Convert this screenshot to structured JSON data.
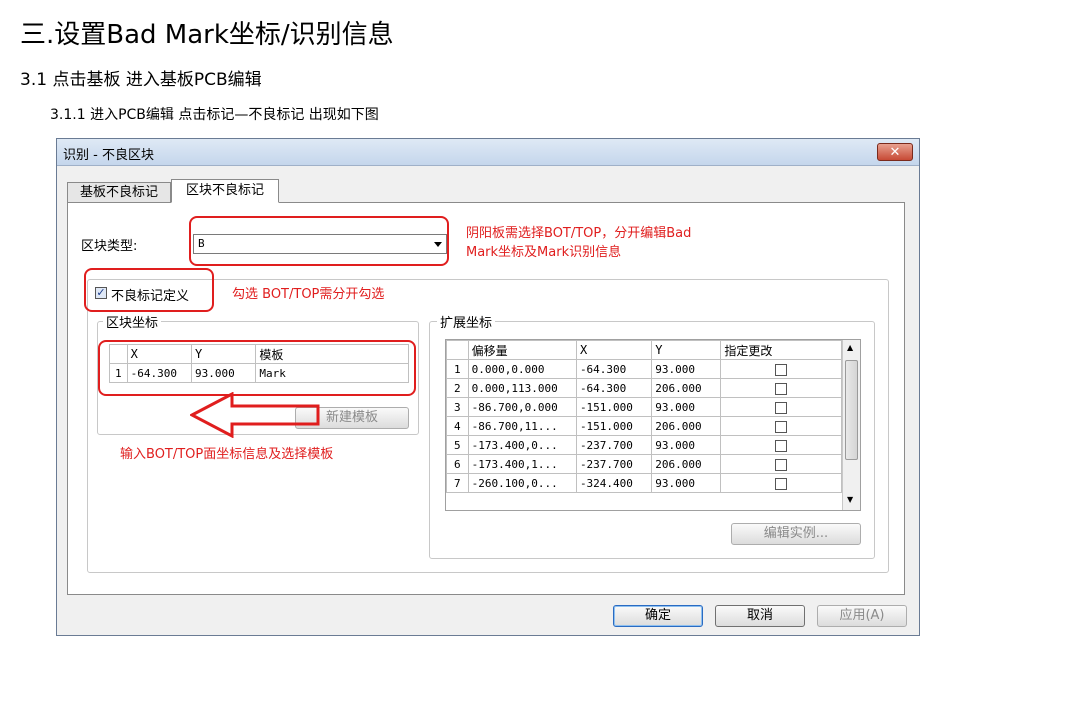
{
  "doc": {
    "h1": "三.设置Bad Mark坐标/识别信息",
    "h2": "3.1 点击基板   进入基板PCB编辑",
    "h3": "3.1.1 进入PCB编辑 点击标记—不良标记  出现如下图"
  },
  "dialog": {
    "title": "识别 - 不良区块",
    "close_glyph": "✕",
    "tabs": [
      "基板不良标记",
      "区块不良标记"
    ],
    "block_type_label": "区块类型:",
    "block_type_value": "B",
    "checkbox_label": "不良标记定义",
    "checkbox_checked": true,
    "block_coords": {
      "title": "区块坐标",
      "headers": [
        "X",
        "Y",
        "模板"
      ],
      "rows": [
        [
          "1",
          "-64.300",
          "93.000",
          "Mark"
        ]
      ],
      "new_template_button": "新建模板"
    },
    "ext_coords": {
      "title": "扩展坐标",
      "headers": [
        "偏移量",
        "X",
        "Y",
        "指定更改"
      ],
      "rows": [
        [
          "1",
          "0.000,0.000",
          "-64.300",
          "93.000"
        ],
        [
          "2",
          "0.000,113.000",
          "-64.300",
          "206.000"
        ],
        [
          "3",
          "-86.700,0.000",
          "-151.000",
          "93.000"
        ],
        [
          "4",
          "-86.700,11...",
          "-151.000",
          "206.000"
        ],
        [
          "5",
          "-173.400,0...",
          "-237.700",
          "93.000"
        ],
        [
          "6",
          "-173.400,1...",
          "-237.700",
          "206.000"
        ],
        [
          "7",
          "-260.100,0...",
          "-324.400",
          "93.000"
        ]
      ],
      "edit_button": "编辑实例..."
    },
    "buttons": {
      "ok": "确定",
      "cancel": "取消",
      "apply": "应用(A)"
    }
  },
  "annotations": {
    "note1_line1": "阴阳板需选择BOT/TOP，分开编辑Bad",
    "note1_line2": "Mark坐标及Mark识别信息",
    "note2": "勾选  BOT/TOP需分开勾选",
    "note3": "输入BOT/TOP面坐标信息及选择模板"
  },
  "colors": {
    "annotation_red": "#e01e1e"
  }
}
